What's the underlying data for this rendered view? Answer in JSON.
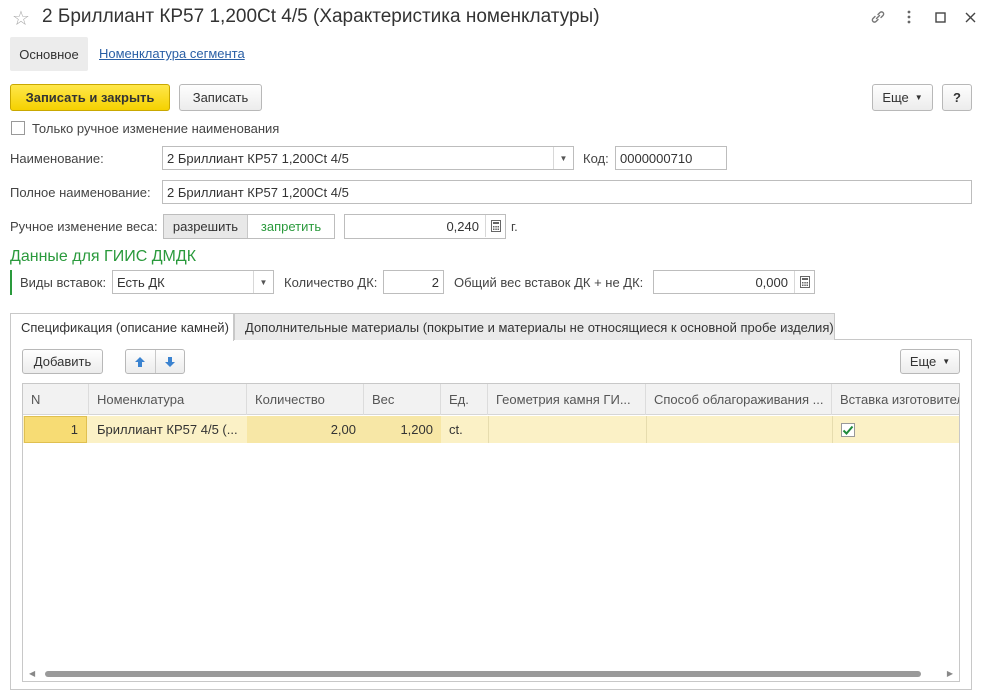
{
  "window": {
    "title": "2 Бриллиант КР57 1,200Ct 4/5 (Характеристика номенклатуры)"
  },
  "sections": {
    "main": "Основное",
    "segment_link": "Номенклатура сегмента"
  },
  "toolbar": {
    "save_close": "Записать и закрыть",
    "save": "Записать",
    "more": "Еще",
    "help": "?"
  },
  "form": {
    "manual_name_checkbox": "Только ручное изменение наименования",
    "manual_name_checked": false,
    "name_label": "Наименование:",
    "name_value": "2 Бриллиант КР57 1,200Ct 4/5",
    "code_label": "Код:",
    "code_value": "0000000710",
    "full_name_label": "Полное наименование:",
    "full_name_value": "2 Бриллиант КР57 1,200Ct 4/5",
    "weight_label": "Ручное изменение веса:",
    "weight_allow": "разрешить",
    "weight_forbid": "запретить",
    "weight_value": "0,240",
    "weight_unit": "г."
  },
  "giis": {
    "title": "Данные для ГИИС ДМДК",
    "insert_types_label": "Виды вставок:",
    "insert_types_value": "Есть ДК",
    "dk_count_label": "Количество ДК:",
    "dk_count_value": "2",
    "total_weight_label": "Общий вес вставок ДК + не ДК:",
    "total_weight_value": "0,000"
  },
  "tabs": [
    {
      "label": "Спецификация (описание камней)",
      "active": true
    },
    {
      "label": "Дополнительные материалы (покрытие и материалы не относящиеся к основной пробе изделия)",
      "active": false
    }
  ],
  "spec": {
    "add_button": "Добавить",
    "more": "Еще",
    "columns": [
      "N",
      "Номенклатура",
      "Количество",
      "Вес",
      "Ед.",
      "Геометрия камня ГИ...",
      "Способ облагораживания ...",
      "Вставка изготовител"
    ],
    "rows": [
      {
        "n": "1",
        "nomenclature": "Бриллиант КР57 4/5 (...",
        "quantity": "2,00",
        "weight": "1,200",
        "unit": "ct.",
        "geometry": "",
        "method": "",
        "manufacturer_insert": true
      }
    ]
  },
  "colors": {
    "accent_yellow": "#f5d100",
    "green": "#2a9a3c",
    "link": "#2a5fa5",
    "row_selected": "#fbf1c6"
  }
}
